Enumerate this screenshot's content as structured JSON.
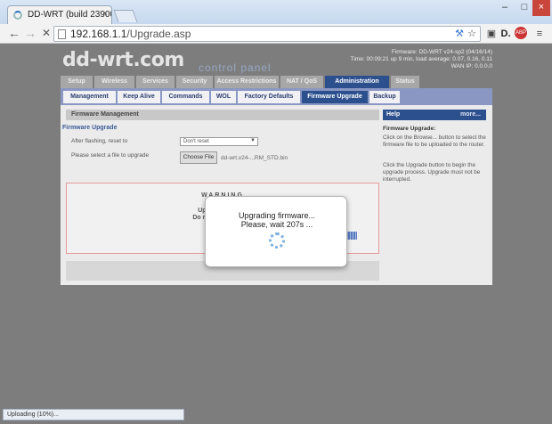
{
  "browser": {
    "tab_title": "DD-WRT (build 23900M) ·",
    "tab_close": "×",
    "url_host": "192.168.1.1",
    "url_path": "/Upgrade.asp",
    "back_glyph": "←",
    "forward_glyph": "→",
    "stop_glyph": "✕",
    "minimize": "–",
    "maximize": "□",
    "close": "×",
    "menu_glyph": "≡"
  },
  "header": {
    "logo": "dd-wrt.com",
    "subtitle": "control panel",
    "firmware": "Firmware: DD-WRT v24-sp2 (04/16/14)",
    "time": "Time: 00:09:21 up 9 min, load average: 0.07, 0.16, 0.11",
    "wan": "WAN IP: 0.0.0.0"
  },
  "main_tabs": [
    "Setup",
    "Wireless",
    "Services",
    "Security",
    "Access Restrictions",
    "NAT / QoS",
    "Administration",
    "Status"
  ],
  "sub_tabs": [
    "Management",
    "Keep Alive",
    "Commands",
    "WOL",
    "Factory Defaults",
    "Firmware Upgrade",
    "Backup"
  ],
  "firmware": {
    "section_title": "Firmware Management",
    "legend": "Firmware Upgrade",
    "after_flash_label": "After flashing, reset to",
    "after_flash_value": "Don't reset",
    "select_file_label": "Please select a file to upgrade",
    "choose_file": "Choose File",
    "file_name": "dd-wrt.v24-...RM_STD.bin"
  },
  "warning": {
    "title": "WARNING",
    "line1": "Upgrading firmw",
    "line2": "Do not turn off the p"
  },
  "help": {
    "head": "Help",
    "more": "more...",
    "subtitle": "Firmware Upgrade:",
    "p1": "Click on the Browse... button to select the firmware file to be uploaded to the router.",
    "p2": "Click the Upgrade button to begin the upgrade process. Upgrade must not be interrupted."
  },
  "modal": {
    "line1": "Upgrading firmware...",
    "line2": "Please, wait 207s ..."
  },
  "status_bar": "Uploading (10%)..."
}
